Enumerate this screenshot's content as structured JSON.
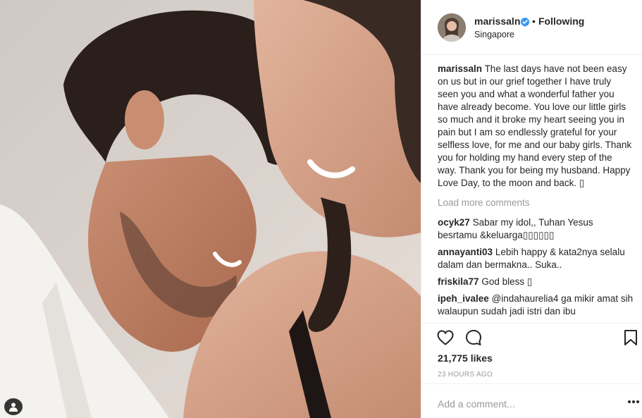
{
  "post": {
    "username": "marissaln",
    "verified_icon": "verified-badge-icon",
    "separator": "•",
    "follow_status": "Following",
    "location": "Singapore",
    "caption": "The last days have not been easy on us but in our grief together I have truly seen you and what a wonderful father you have already become. You love our little girls so much and it broke my heart seeing you in pain but I am so endlessly grateful for your selfless love, for me and our baby girls. Thank you for holding my hand every step of the way. Thank you for being my husband. Happy Love Day, to the moon and back. ▯",
    "load_more": "Load more comments",
    "comments": [
      {
        "user": "ocyk27",
        "text": "Sabar my idol,, Tuhan Yesus besrtamu &keluarga▯▯▯▯▯▯"
      },
      {
        "user": "annayanti03",
        "text": "Lebih happy & kata2nya selalu dalam dan bermakna.. Suka.."
      },
      {
        "user": "friskila77",
        "text": "God bless ▯"
      },
      {
        "user": "ipeh_ivalee",
        "text": "@indahaurelia4 ga mikir amat sih walaupun sudah jadi istri dan ibu"
      }
    ],
    "likes": "21,775 likes",
    "timestamp": "23 HOURS AGO",
    "add_comment_placeholder": "Add a comment...",
    "icons": {
      "like": "heart-icon",
      "comment": "comment-bubble-icon",
      "save": "bookmark-icon",
      "more": "more-options-icon",
      "tag": "user-tag-icon"
    },
    "colors": {
      "text": "#262626",
      "muted": "#999999",
      "verified": "#3897f0",
      "border": "#efefef"
    }
  }
}
